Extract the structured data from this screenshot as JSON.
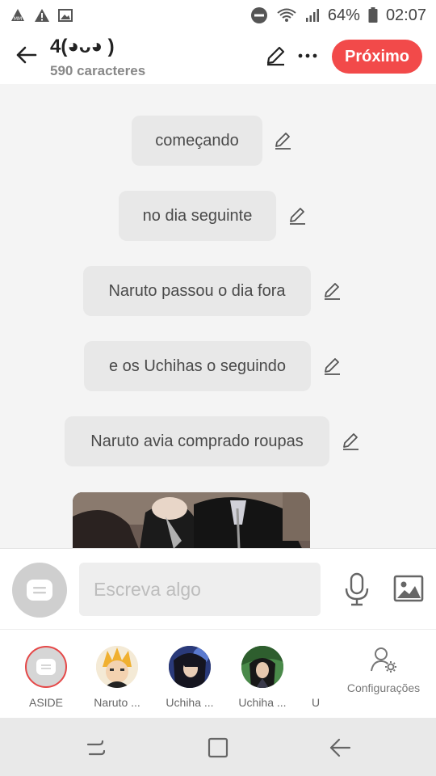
{
  "status_bar": {
    "battery": "64%",
    "time": "02:07"
  },
  "header": {
    "title": "4(◕ᴗ◕ )",
    "subtitle": "590 caracteres",
    "next_label": "Próximo"
  },
  "messages": [
    {
      "text": "começando"
    },
    {
      "text": "no dia seguinte"
    },
    {
      "text": "Naruto passou o dia fora"
    },
    {
      "text": "e os Uchihas o seguindo"
    },
    {
      "text": "Naruto avia comprado roupas"
    }
  ],
  "composer": {
    "placeholder": "Escreva algo"
  },
  "characters": [
    {
      "name": "ASIDE"
    },
    {
      "name": "Naruto ..."
    },
    {
      "name": "Uchiha ..."
    },
    {
      "name": "Uchiha ..."
    },
    {
      "name": "U"
    }
  ],
  "settings_label": "Configurações",
  "colors": {
    "accent": "#f24a4a",
    "bubble": "#e8e8e8",
    "background": "#f4f4f4"
  }
}
